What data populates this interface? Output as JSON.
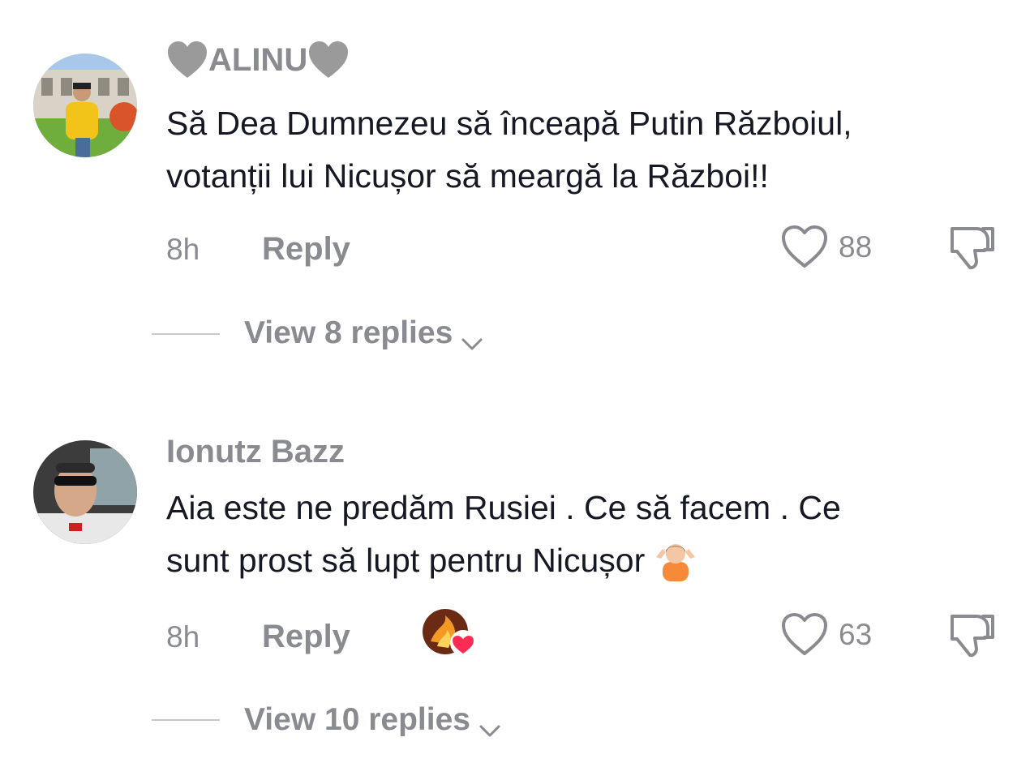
{
  "comments": [
    {
      "username": "ALINU",
      "username_decor": "heart-emoji-grey",
      "text_lines": [
        "Să Dea Dumnezeu să înceapă Putin Războiul,",
        "votanții lui Nicușor să meargă la Război!!"
      ],
      "time": "8h",
      "reply_label": "Reply",
      "likes": "88",
      "view_replies": "View 8 replies"
    },
    {
      "username": "Ionutz Bazz",
      "text_lines": [
        "Aia este ne predăm Rusiei . Ce să facem . Ce",
        "sunt prost să lupt pentru Nicușor"
      ],
      "emoji": "person-shrugging-emoji",
      "time": "8h",
      "reply_label": "Reply",
      "creator_liked": true,
      "likes": "63",
      "view_replies": "View 10 replies"
    }
  ],
  "colors": {
    "text": "#161823",
    "muted": "#8a8b91",
    "divider": "#c9c9cc",
    "creator_heart": "#fe2c55"
  },
  "icons": [
    "heart-outline-icon",
    "dislike-icon",
    "chevron-down-icon",
    "creator-liked-badge"
  ]
}
